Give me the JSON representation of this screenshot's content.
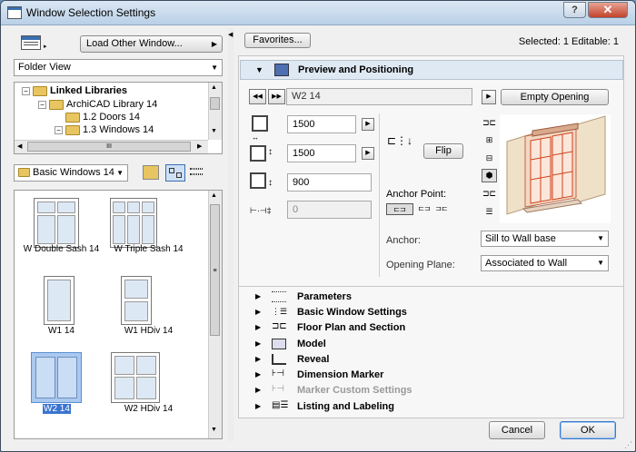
{
  "window": {
    "title": "Window Selection Settings",
    "help": "?",
    "close": "✕"
  },
  "left": {
    "load_other": "Load Other Window...",
    "folder_view": "Folder View",
    "tree": [
      {
        "label": "Linked Libraries",
        "bold": true
      },
      {
        "label": "ArchiCAD Library 14",
        "bold": false
      },
      {
        "label": "1.2 Doors 14",
        "bold": false
      },
      {
        "label": "1.3 Windows 14",
        "bold": false
      }
    ],
    "scroll_grip": "III",
    "folder_combo": "Basic Windows 14",
    "thumbnails": [
      {
        "label": "W Double Sash 14",
        "selected": false
      },
      {
        "label": "W Triple Sash 14",
        "selected": false
      },
      {
        "label": "W1 14",
        "selected": false
      },
      {
        "label": "W1 HDiv 14",
        "selected": false
      },
      {
        "label": "W2 14",
        "selected": true
      },
      {
        "label": "W2 HDiv 14",
        "selected": false
      }
    ]
  },
  "right": {
    "favorites": "Favorites...",
    "status": "Selected: 1 Editable: 1",
    "section_title": "Preview and Positioning",
    "name": "W2 14",
    "empty_opening": "Empty Opening",
    "width": "1500",
    "height": "1500",
    "sill": "900",
    "sill_disabled": "0",
    "flip": "Flip",
    "anchor_point_label": "Anchor Point:",
    "anchor_label": "Anchor:",
    "anchor_value": "Sill to Wall base",
    "opening_plane_label": "Opening Plane:",
    "opening_plane_value": "Associated to Wall"
  },
  "sections": [
    {
      "label": "Parameters",
      "dim": false
    },
    {
      "label": "Basic Window Settings",
      "dim": false
    },
    {
      "label": "Floor Plan and Section",
      "dim": false
    },
    {
      "label": "Model",
      "dim": false
    },
    {
      "label": "Reveal",
      "dim": false
    },
    {
      "label": "Dimension Marker",
      "dim": false
    },
    {
      "label": "Marker Custom Settings",
      "dim": true
    },
    {
      "label": "Listing and Labeling",
      "dim": false
    }
  ],
  "footer": {
    "cancel": "Cancel",
    "ok": "OK"
  }
}
